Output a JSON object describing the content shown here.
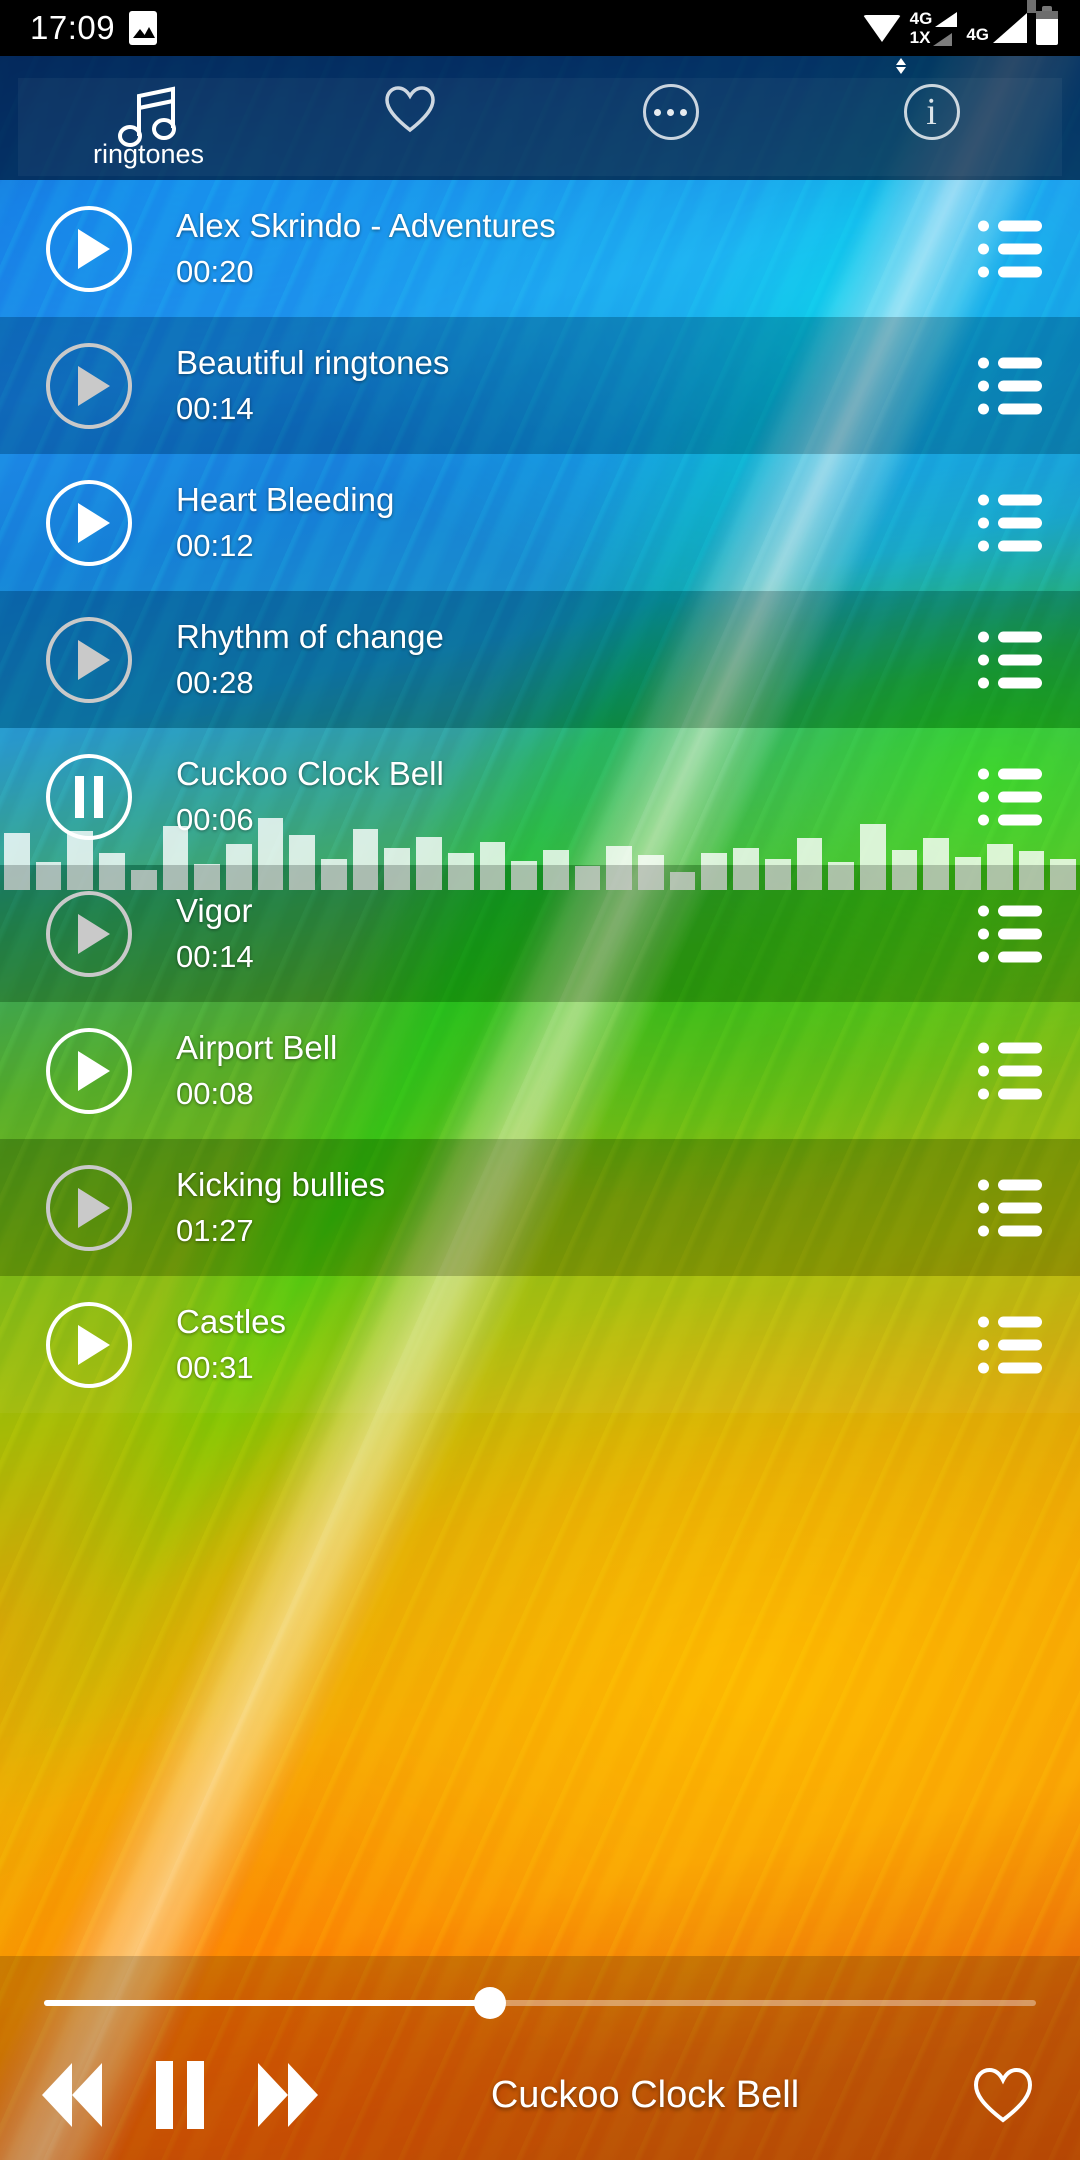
{
  "status_bar": {
    "time": "17:09",
    "left_icons": [
      "photo-icon"
    ],
    "right_icons": [
      "wifi-icon",
      "signal-4g-1x-icon",
      "signal-4g-icon",
      "battery-icon"
    ],
    "network_labels": {
      "top": "4G",
      "bottom": "1X",
      "sim2": "4G"
    }
  },
  "toolbar": {
    "items": [
      {
        "icon": "music-note-icon",
        "label": "ringtones"
      },
      {
        "icon": "heart-outline-icon",
        "label": ""
      },
      {
        "icon": "more-options-icon",
        "label": ""
      },
      {
        "icon": "info-icon",
        "label": ""
      }
    ]
  },
  "list": {
    "tracks": [
      {
        "title": "Alex Skrindo - Adventures",
        "duration": "00:20",
        "state": "idle",
        "shade": "bright",
        "menu_icon": "list-menu-icon",
        "play_icon": "play-icon"
      },
      {
        "title": "Beautiful ringtones",
        "duration": "00:14",
        "state": "idle",
        "shade": "dim",
        "menu_icon": "list-menu-icon",
        "play_icon": "play-icon"
      },
      {
        "title": "Heart Bleeding",
        "duration": "00:12",
        "state": "idle",
        "shade": "bright",
        "menu_icon": "list-menu-icon",
        "play_icon": "play-icon"
      },
      {
        "title": "Rhythm of change",
        "duration": "00:28",
        "state": "idle",
        "shade": "dim",
        "menu_icon": "list-menu-icon",
        "play_icon": "play-icon"
      },
      {
        "title": "Cuckoo Clock Bell",
        "duration": "00:06",
        "state": "playing",
        "shade": "playing",
        "menu_icon": "list-menu-icon",
        "play_icon": "pause-icon"
      },
      {
        "title": "Vigor",
        "duration": "00:14",
        "state": "idle",
        "shade": "dim",
        "menu_icon": "list-menu-icon",
        "play_icon": "play-icon"
      },
      {
        "title": "Airport Bell",
        "duration": "00:08",
        "state": "idle",
        "shade": "bright",
        "menu_icon": "list-menu-icon",
        "play_icon": "play-icon"
      },
      {
        "title": "Kicking bullies",
        "duration": "01:27",
        "state": "idle",
        "shade": "dim",
        "menu_icon": "list-menu-icon",
        "play_icon": "play-icon"
      },
      {
        "title": "Castles",
        "duration": "00:31",
        "state": "idle",
        "shade": "bright",
        "menu_icon": "list-menu-icon",
        "play_icon": "play-icon"
      }
    ]
  },
  "visualizer": {
    "bar_count": 34,
    "levels": [
      62,
      30,
      64,
      40,
      22,
      70,
      28,
      50,
      78,
      60,
      34,
      66,
      46,
      58,
      40,
      52,
      32,
      44,
      26,
      48,
      38,
      20,
      40,
      46,
      34,
      56,
      30,
      72,
      44,
      56,
      36,
      50,
      42,
      34
    ]
  },
  "player": {
    "now_playing": "Cuckoo Clock Bell",
    "progress_percent": 45,
    "controls": [
      {
        "icon": "rewind-icon",
        "label": ""
      },
      {
        "icon": "pause-icon",
        "label": ""
      },
      {
        "icon": "forward-icon",
        "label": ""
      }
    ],
    "favorite_icon": "heart-outline-icon"
  },
  "colors": {
    "accent_white": "#ffffff",
    "idle_play_button": "#c9c9c9",
    "toolbar_background": "#021634",
    "status_bar_background": "#000000"
  }
}
